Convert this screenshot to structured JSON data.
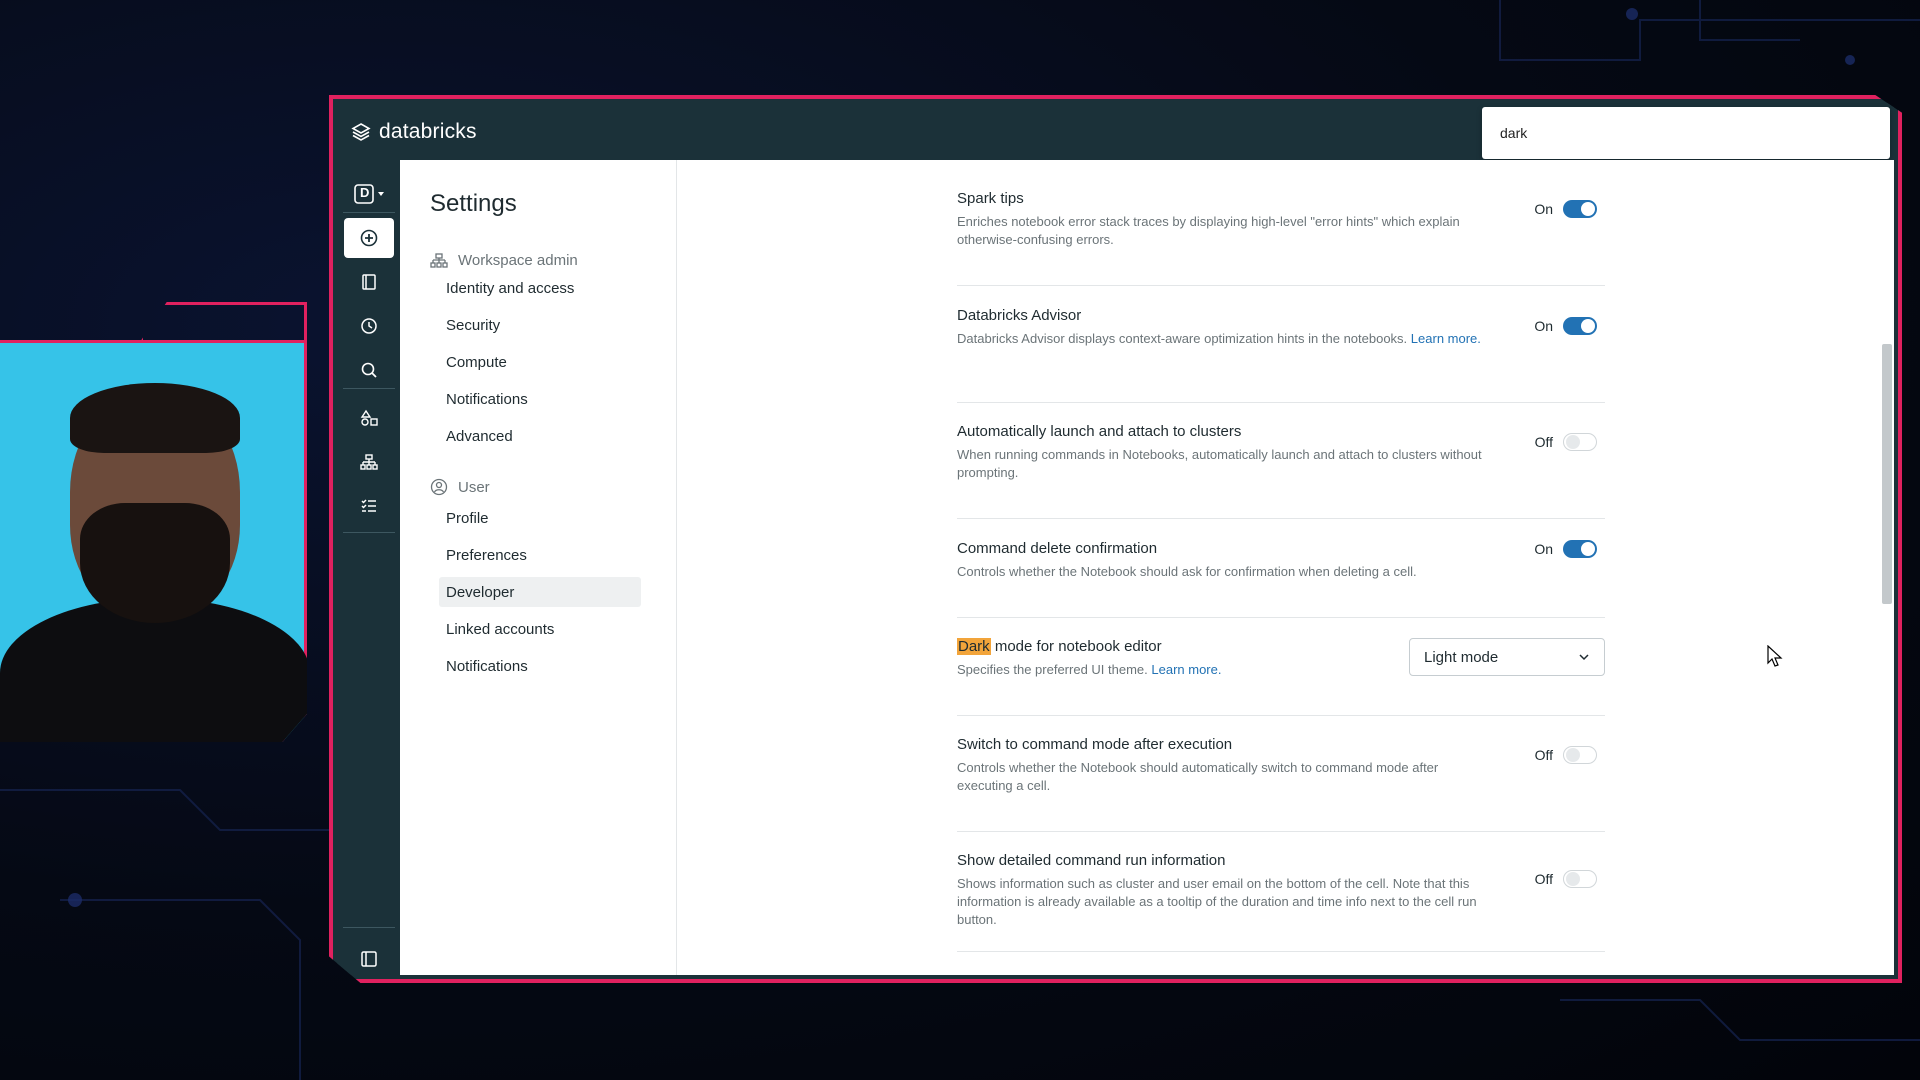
{
  "app": {
    "logo_text": "databricks",
    "search_value": "dark"
  },
  "rail": {
    "workspace_initial": "D",
    "items": [
      "new-icon",
      "notebook-icon",
      "recents-icon",
      "search-icon",
      "shapes-icon",
      "org-icon",
      "tasks-icon"
    ],
    "bottom": "sidebar-toggle-icon"
  },
  "settings": {
    "title": "Settings",
    "groups": [
      {
        "label": "Workspace admin",
        "icon": "org-icon",
        "items": [
          "Identity and access",
          "Security",
          "Compute",
          "Notifications",
          "Advanced"
        ]
      },
      {
        "label": "User",
        "icon": "user-icon",
        "items": [
          "Profile",
          "Preferences",
          "Developer",
          "Linked accounts",
          "Notifications"
        ]
      }
    ],
    "selected": "Developer"
  },
  "rows": [
    {
      "title": "Spark tips",
      "desc": "Enriches notebook error stack traces by displaying high-level \"error hints\" which explain otherwise-confusing errors.",
      "state_label": "On",
      "on": true
    },
    {
      "title": "Databricks Advisor",
      "desc": "Databricks Advisor displays context-aware optimization hints in the notebooks.",
      "link": "Learn more.",
      "state_label": "On",
      "on": true
    },
    {
      "title": "Automatically launch and attach to clusters",
      "desc": "When running commands in Notebooks, automatically launch and attach to clusters without prompting.",
      "state_label": "Off",
      "on": false
    },
    {
      "title": "Command delete confirmation",
      "desc": "Controls whether the Notebook should ask for confirmation when deleting a cell.",
      "state_label": "On",
      "on": true
    },
    {
      "title_highlight": "Dark",
      "title_rest": " mode for notebook editor",
      "desc": "Specifies the preferred UI theme.",
      "link": "Learn more.",
      "select_value": "Light mode"
    },
    {
      "title": "Switch to command mode after execution",
      "desc": "Controls whether the Notebook should automatically switch to command mode after executing a cell.",
      "state_label": "Off",
      "on": false
    },
    {
      "title": "Show detailed command run information",
      "desc": "Shows information such as cluster and user email on the bottom of the cell. Note that this information is already available as a tooltip of the duration and time info next to the cell run button.",
      "state_label": "Off",
      "on": false
    }
  ],
  "colors": {
    "frame_accent": "#e0215f",
    "topbar": "#1b3139",
    "toggle_on": "#2272b4",
    "highlight": "#f2a43a"
  }
}
